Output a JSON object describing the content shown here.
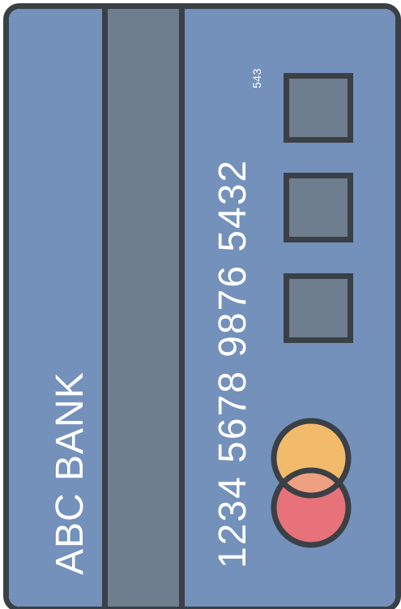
{
  "card": {
    "bank_name": "ABC BANK",
    "number": "1234 5678 9876 5432",
    "cvv": "543"
  },
  "icons": {
    "chips": [
      "square-chip-icon",
      "square-chip-icon",
      "square-chip-icon"
    ],
    "logo": "overlapping-circles-logo-icon"
  },
  "colors": {
    "card_body": "#7491bc",
    "stripe": "#6e7e8f",
    "outline": "#3a4046",
    "chip_fill": "#6e7e8f",
    "circle_top": "#f2bb6b",
    "circle_bottom": "#e7727a",
    "circle_overlap": "#ef9f82",
    "text": "#ffffff"
  }
}
